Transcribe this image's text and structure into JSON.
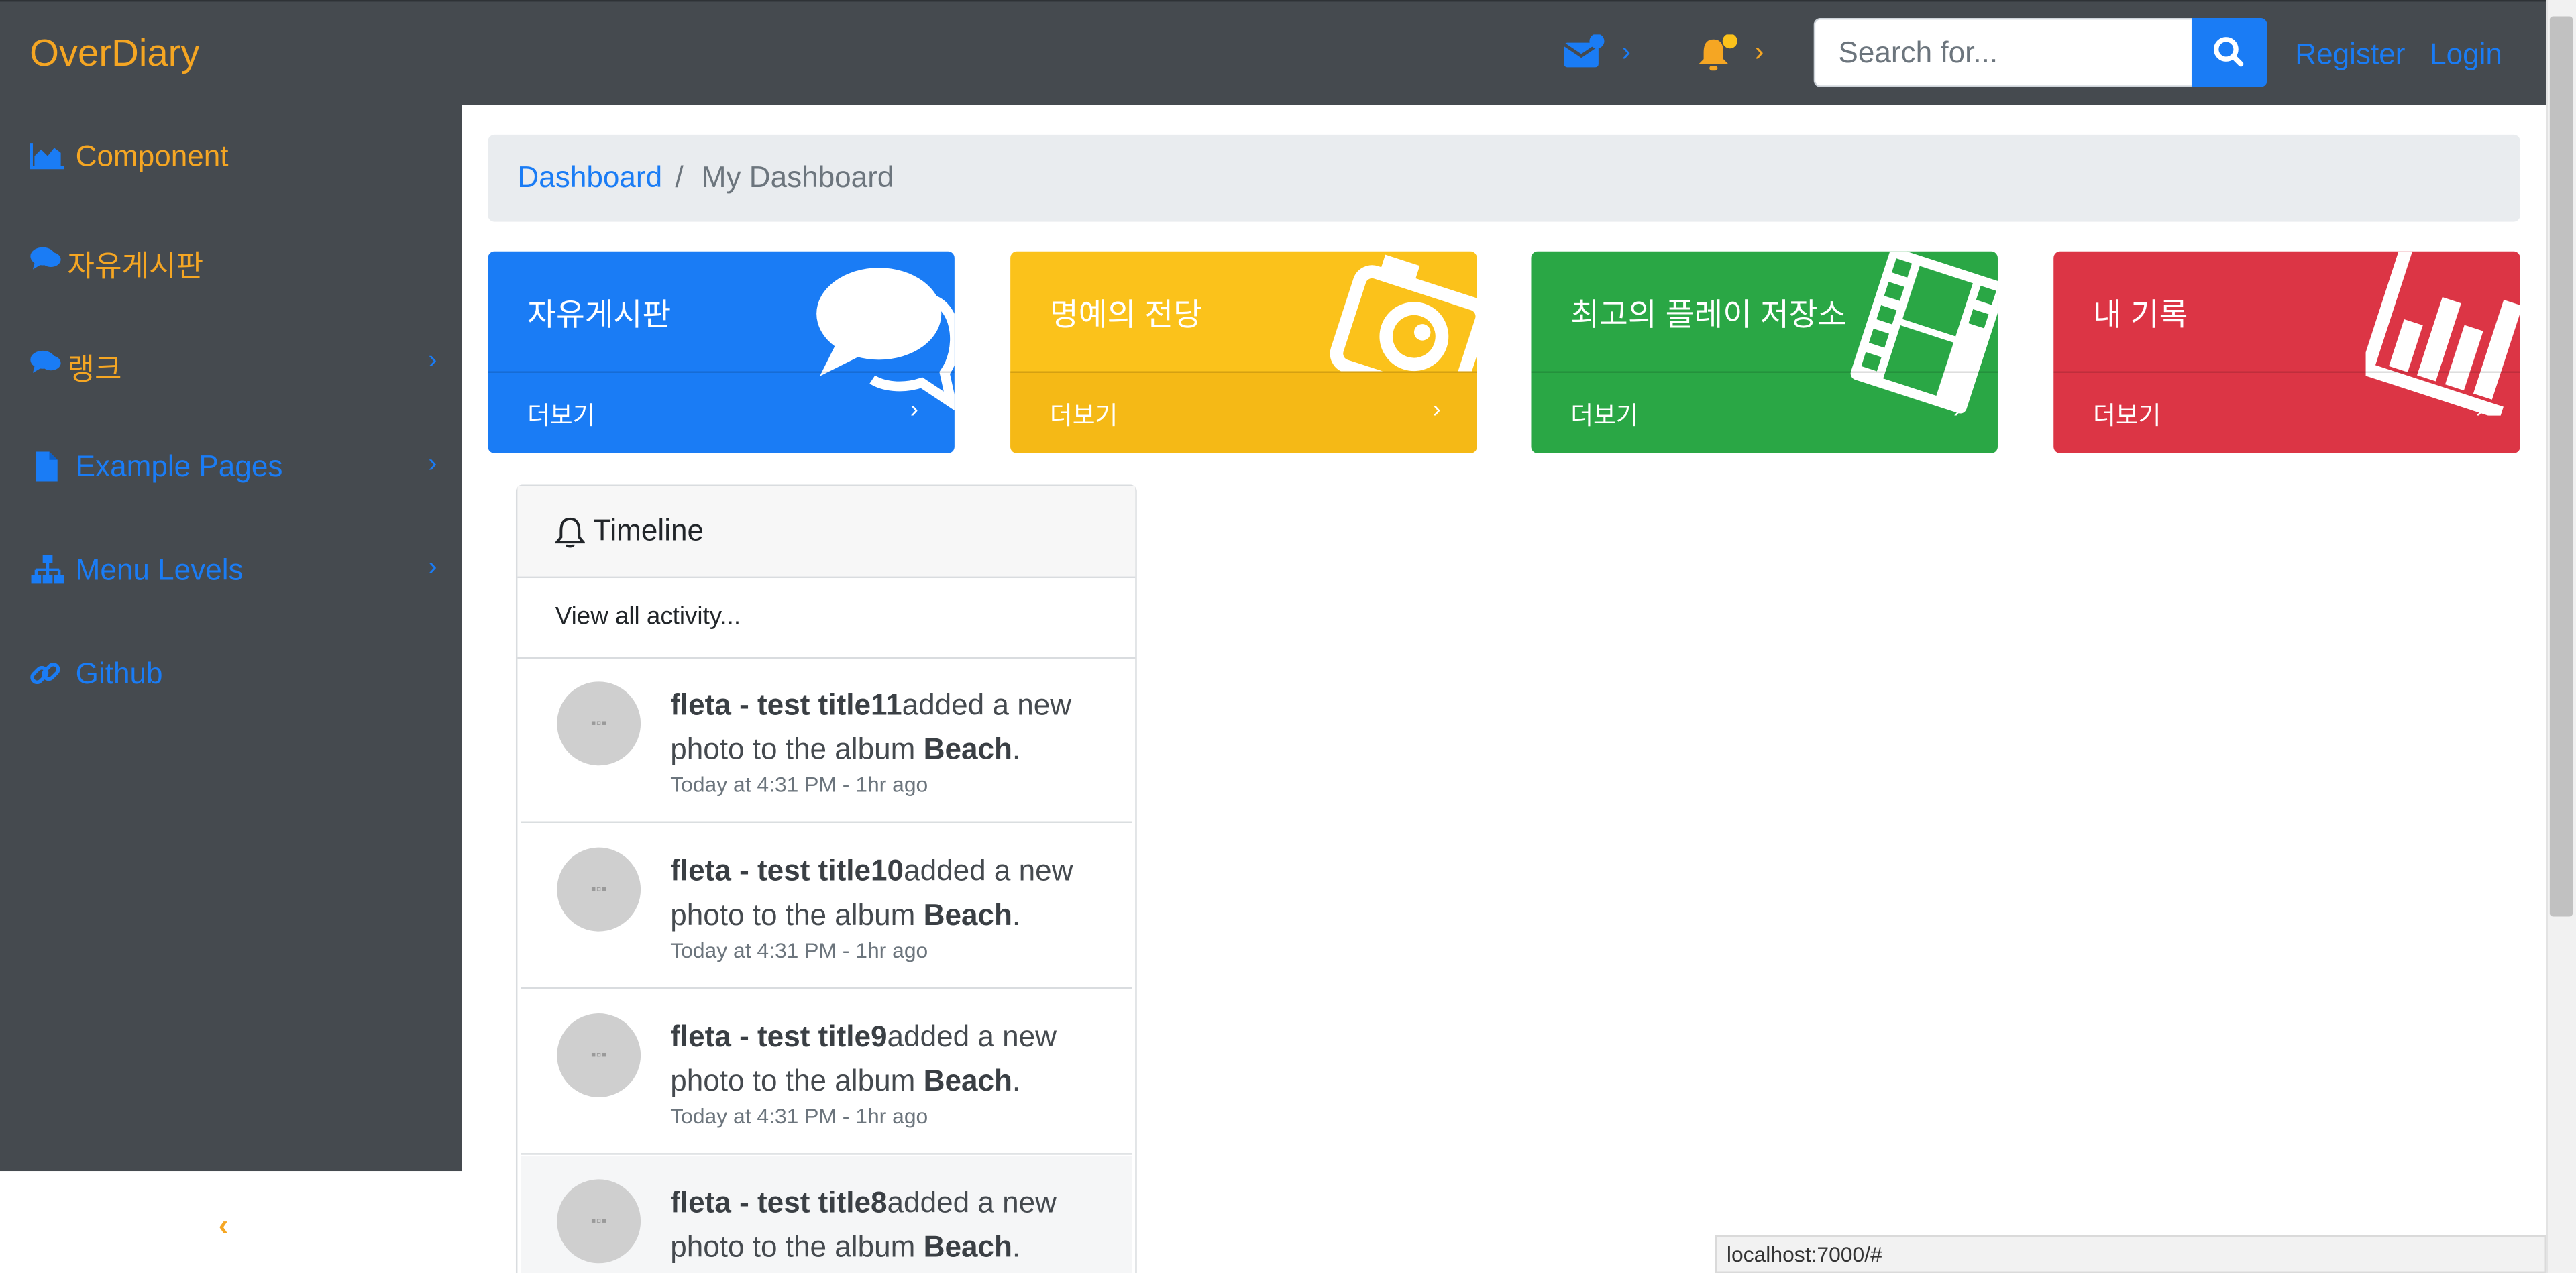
{
  "navbar": {
    "brand": "OverDiary",
    "search_placeholder": "Search for...",
    "register": "Register",
    "login": "Login",
    "icons": [
      "envelope-icon",
      "bell-icon",
      "search-icon"
    ],
    "colors": {
      "bar": "#454a4f",
      "brand": "#f5a623",
      "link": "#1a7cf5"
    }
  },
  "sidebar": {
    "items": [
      {
        "label": "Component",
        "icon": "area-chart-icon"
      },
      {
        "label": "자유게시판",
        "icon": "comments-icon"
      },
      {
        "label": "랭크",
        "icon": "comments-icon",
        "has_submenu": true
      },
      {
        "label": "Example Pages",
        "icon": "file-icon",
        "has_submenu": true
      },
      {
        "label": "Menu Levels",
        "icon": "sitemap-icon",
        "has_submenu": true
      },
      {
        "label": "Github",
        "icon": "link-icon"
      }
    ],
    "toggle_glyph": "‹"
  },
  "breadcrumb": {
    "link": "Dashboard",
    "separator": "/",
    "current": "My Dashboard"
  },
  "cards": [
    {
      "title": "자유게시판",
      "more": "더보기",
      "color": "#1a7cf5",
      "icon": "comments-icon"
    },
    {
      "title": "명예의 전당",
      "more": "더보기",
      "color": "#fbc21b",
      "icon": "camera-icon"
    },
    {
      "title": "최고의 플레이 저장소",
      "more": "더보기",
      "color": "#2aa745",
      "icon": "film-icon"
    },
    {
      "title": "내 기록",
      "more": "더보기",
      "color": "#dc3545",
      "icon": "bar-chart-icon"
    }
  ],
  "timeline": {
    "title": "Timeline",
    "view_all": "View all activity...",
    "items": [
      {
        "user": "fleta - test title11",
        "action": "added a new photo to the album ",
        "album": "Beach",
        "time": "Today at 4:31 PM - 1hr ago"
      },
      {
        "user": "fleta - test title10",
        "action": "added a new photo to the album ",
        "album": "Beach",
        "time": "Today at 4:31 PM - 1hr ago"
      },
      {
        "user": "fleta - test title9",
        "action": "added a new photo to the album ",
        "album": "Beach",
        "time": "Today at 4:31 PM - 1hr ago"
      },
      {
        "user": "fleta - test title8",
        "action": "added a new photo to the album ",
        "album": "Beach",
        "time": ""
      }
    ]
  },
  "status_url": "localhost:7000/#"
}
